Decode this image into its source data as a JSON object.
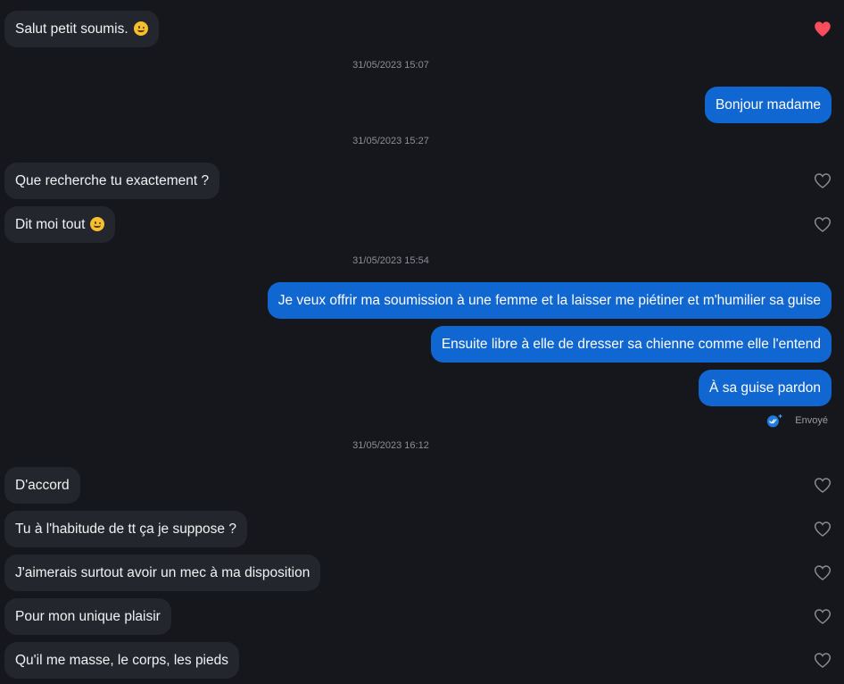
{
  "chat": {
    "messages": [
      {
        "text": "Salut petit soumis.",
        "emoji": "wink-face-icon"
      },
      {
        "text": "Bonjour madame"
      },
      {
        "text": "Que recherche tu exactement ?"
      },
      {
        "text": "Dit moi tout",
        "emoji": "wink-face-icon"
      },
      {
        "text": "Je veux offrir ma soumission à une femme et la laisser me piétiner et m'humilier sa guise"
      },
      {
        "text": "Ensuite libre à elle de dresser sa chienne comme elle l'entend"
      },
      {
        "text": "À sa guise pardon"
      },
      {
        "text": "D'accord"
      },
      {
        "text": "Tu à l'habitude de tt ça je suppose ?"
      },
      {
        "text": "J'aimerais surtout avoir un mec à ma disposition"
      },
      {
        "text": "Pour mon unique plaisir"
      },
      {
        "text": "Qu'il me masse, le corps, les pieds"
      }
    ],
    "timestamps": [
      "31/05/2023 15:07",
      "31/05/2023 15:27",
      "31/05/2023 15:54",
      "31/05/2023 16:12"
    ],
    "status": {
      "label": "Envoyé",
      "icon": "double-check-icon"
    },
    "colors": {
      "background": "#15171c",
      "incoming_bubble": "#24262d",
      "outgoing_bubble": "#1167d2",
      "liked_heart": "#ff4d5e",
      "unliked_heart": "#8a8c92"
    }
  }
}
